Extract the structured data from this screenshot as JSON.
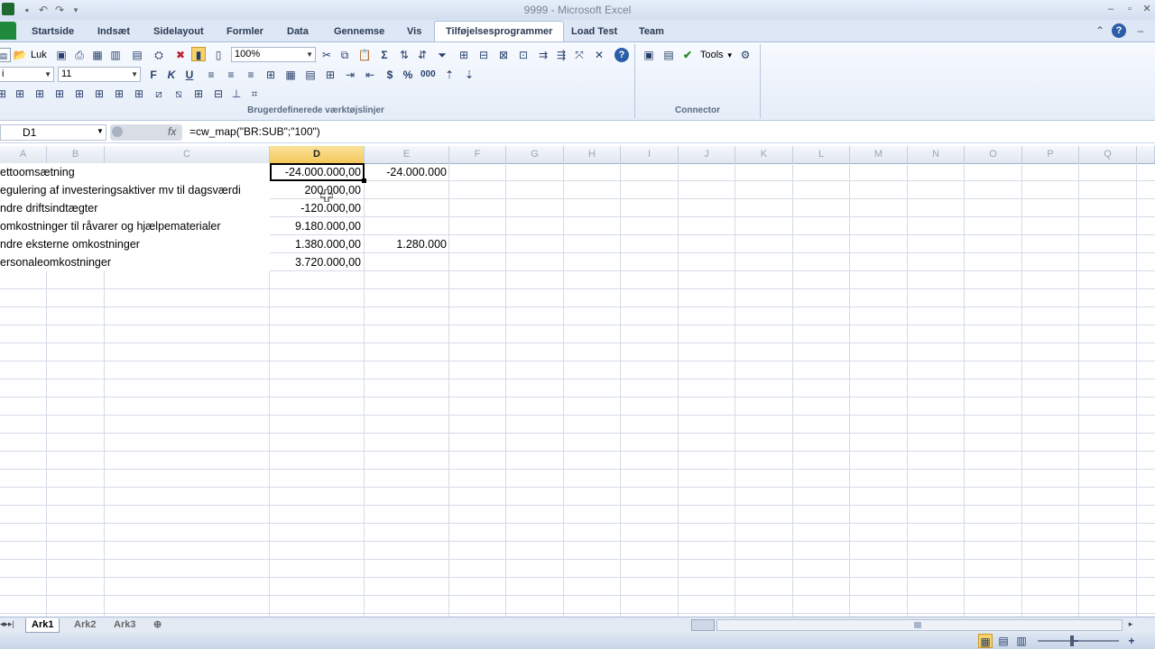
{
  "window": {
    "title": "9999 - Microsoft Excel"
  },
  "tabs": [
    "Startside",
    "Indsæt",
    "Sidelayout",
    "Formler",
    "Data",
    "Gennemse",
    "Vis",
    "Tilføjelsesprogrammer",
    "Load Test",
    "Team"
  ],
  "active_tab": "Tilføjelsesprogrammer",
  "ribbon": {
    "close_label": "Luk",
    "font_name": "i",
    "font_size": "11",
    "zoom": "100%",
    "tools_label": "Tools",
    "group_custom_toolbars": "Brugerdefinerede værktøjslinjer",
    "group_connector": "Connector",
    "bold": "F",
    "italic": "K",
    "underline": "U",
    "sigma": "Σ",
    "currency": "$",
    "percent": "%",
    "thousands": "000"
  },
  "formula_bar": {
    "name_box": "D1",
    "formula": "=cw_map(\"BR:SUB\";\"100\")"
  },
  "columns": [
    "A",
    "B",
    "C",
    "D",
    "E",
    "F",
    "G",
    "H",
    "I",
    "J",
    "K",
    "L",
    "M",
    "N",
    "O",
    "P",
    "Q"
  ],
  "selected_column": "D",
  "rows": [
    {
      "label": "ettoomsætning",
      "d": "-24.000.000,00",
      "e": "-24.000.000"
    },
    {
      "label": "egulering af investeringsaktiver mv til dagsværdi",
      "d": "200.000,00",
      "e": ""
    },
    {
      "label": "ndre driftsindtægter",
      "d": "-120.000,00",
      "e": ""
    },
    {
      "label": "omkostninger til råvarer og hjælpematerialer",
      "d": "9.180.000,00",
      "e": ""
    },
    {
      "label": "ndre eksterne omkostninger",
      "d": "1.380.000,00",
      "e": "1.280.000"
    },
    {
      "label": "ersonaleomkostninger",
      "d": "3.720.000,00",
      "e": ""
    }
  ],
  "sheets": [
    "Ark1",
    "Ark2",
    "Ark3"
  ],
  "active_sheet": "Ark1",
  "colors": {
    "file_tab": "#1f8a3b",
    "selected_header": "#f5c75a",
    "ribbon_bg": "#e5edf8"
  }
}
